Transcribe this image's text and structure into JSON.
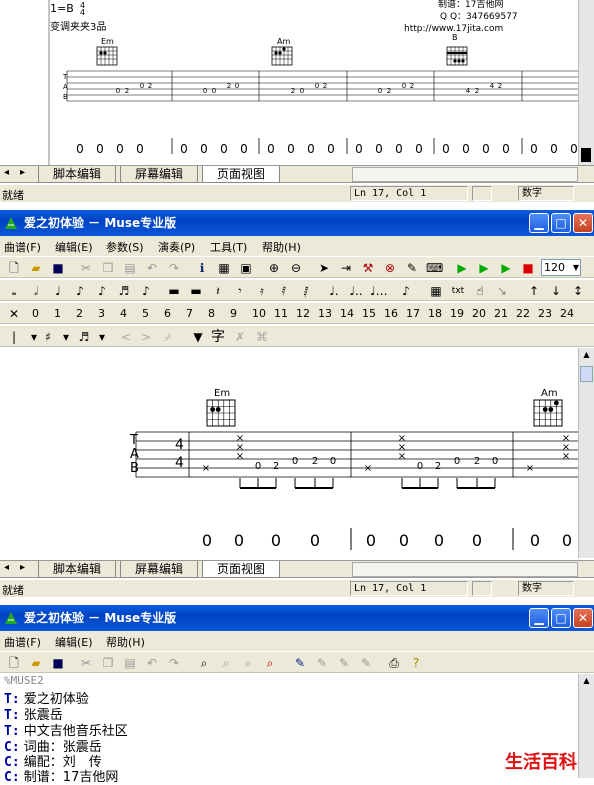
{
  "top_score": {
    "key": "1=B",
    "time_top": "4",
    "time_bottom": "4",
    "capo": "变调夹夹3品",
    "credits": [
      "制谱：17吉他网",
      "Q Q：347669577",
      "http://www.17jita.com"
    ],
    "chords": [
      "Em",
      "Am",
      "B"
    ],
    "tab_letters": [
      "T",
      "A",
      "B"
    ],
    "tab_marks": [
      "0",
      "2",
      "0",
      "2",
      "0",
      "0",
      "2",
      "0",
      "2",
      "0",
      "0",
      "2",
      "0",
      "2",
      "0",
      "2",
      "4",
      "2",
      "4",
      "2"
    ],
    "beat_zeros": [
      "0",
      "0",
      "0",
      "0",
      "0",
      "0",
      "0",
      "0",
      "0",
      "0",
      "0",
      "0",
      "0",
      "0",
      "0",
      "0",
      "0",
      "0",
      "0",
      "0",
      "0",
      "0",
      "0",
      "0"
    ]
  },
  "tabs": [
    "脚本编辑",
    "屏幕编辑",
    "页面视图"
  ],
  "status": {
    "ready": "就绪",
    "position": "Ln 17, Col 1",
    "mode": "数字"
  },
  "win1": {
    "title": "爱之初体验 － Muse专业版",
    "menu": [
      "曲谱(F)",
      "编辑(E)",
      "参数(S)",
      "演奏(P)",
      "工具(T)",
      "帮助(H)"
    ],
    "zoom": "120",
    "numbers": [
      "0",
      "1",
      "2",
      "3",
      "4",
      "5",
      "6",
      "7",
      "8",
      "9",
      "10",
      "11",
      "12",
      "13",
      "14",
      "15",
      "16",
      "17",
      "18",
      "19",
      "20",
      "21",
      "22",
      "23",
      "24"
    ],
    "char_tool": "字",
    "score": {
      "chords": [
        "Em",
        "Am"
      ],
      "time_top": "4",
      "time_bottom": "4",
      "tab_letters": [
        "T",
        "A",
        "B"
      ],
      "tab_marks": [
        "0",
        "2",
        "0",
        "2",
        "0",
        "0",
        "2",
        "0",
        "2",
        "0"
      ],
      "beat_zeros": [
        "0",
        "0",
        "0",
        "0",
        "0",
        "0",
        "0",
        "0",
        "0",
        "0"
      ]
    }
  },
  "win2": {
    "title": "爱之初体验 － Muse专业版",
    "menu": [
      "曲谱(F)",
      "编辑(E)",
      "帮助(H)"
    ],
    "lines": [
      {
        "key": "",
        "text": "%MUSE2"
      },
      {
        "key": "T:",
        "text": "爱之初体验"
      },
      {
        "key": "T:",
        "text": "张震岳"
      },
      {
        "key": "T:",
        "text": "中文吉他音乐社区"
      },
      {
        "key": "C:",
        "text": "词曲：张震岳"
      },
      {
        "key": "C:",
        "text": "编配：刘　传"
      },
      {
        "key": "C:",
        "text": "制谱：17吉他网"
      }
    ]
  },
  "watermark": "生活百科"
}
